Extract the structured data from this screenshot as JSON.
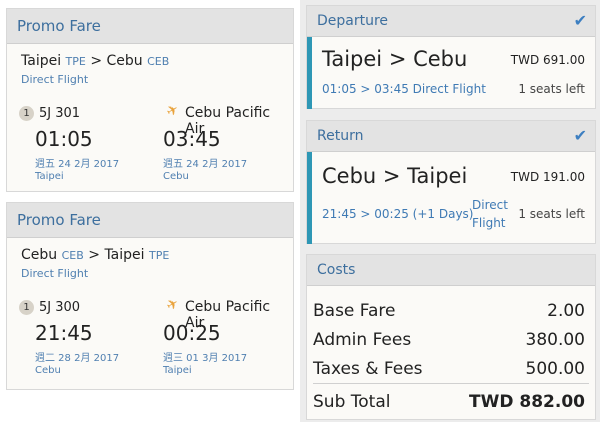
{
  "left": {
    "cards": [
      {
        "header": "Promo Fare",
        "from_city": "Taipei",
        "from_code": "TPE",
        "arrow": ">",
        "to_city": "Cebu",
        "to_code": "CEB",
        "direct_label": "Direct Flight",
        "segment_number": "1",
        "flight_number": "5J 301",
        "airline": "Cebu Pacific Air",
        "depart_time": "01:05",
        "arrive_time": "03:45",
        "depart_date": "週五 24 2月 2017",
        "arrive_date": "週五 24 2月 2017",
        "depart_city": "Taipei",
        "arrive_city": "Cebu"
      },
      {
        "header": "Promo Fare",
        "from_city": "Cebu",
        "from_code": "CEB",
        "arrow": ">",
        "to_city": "Taipei",
        "to_code": "TPE",
        "direct_label": "Direct Flight",
        "segment_number": "1",
        "flight_number": "5J 300",
        "airline": "Cebu Pacific Air",
        "depart_time": "21:45",
        "arrive_time": "00:25",
        "depart_date": "週二 28 2月 2017",
        "arrive_date": "週三 01 3月 2017",
        "depart_city": "Cebu",
        "arrive_city": "Taipei"
      }
    ]
  },
  "right": {
    "departure": {
      "header": "Departure",
      "route": "Taipei > Cebu",
      "price": "TWD 691.00",
      "times": "01:05 > 03:45 Direct Flight",
      "seats": "1 seats left"
    },
    "return": {
      "header": "Return",
      "route": "Cebu > Taipei",
      "price": "TWD 191.00",
      "times": "21:45 > 00:25 (+1 Days)",
      "direct_line1": "Direct",
      "direct_line2": "Flight",
      "seats": "1 seats left"
    },
    "costs": {
      "header": "Costs",
      "rows": [
        {
          "label": "Base Fare",
          "value": "2.00"
        },
        {
          "label": "Admin Fees",
          "value": "380.00"
        },
        {
          "label": "Taxes & Fees",
          "value": "500.00"
        }
      ],
      "subtotal_label": "Sub Total",
      "subtotal_value": "TWD 882.00"
    }
  },
  "colors": {
    "accent": "#2e97b5",
    "link": "#4f7fb0",
    "plane": "#e9a23b"
  }
}
